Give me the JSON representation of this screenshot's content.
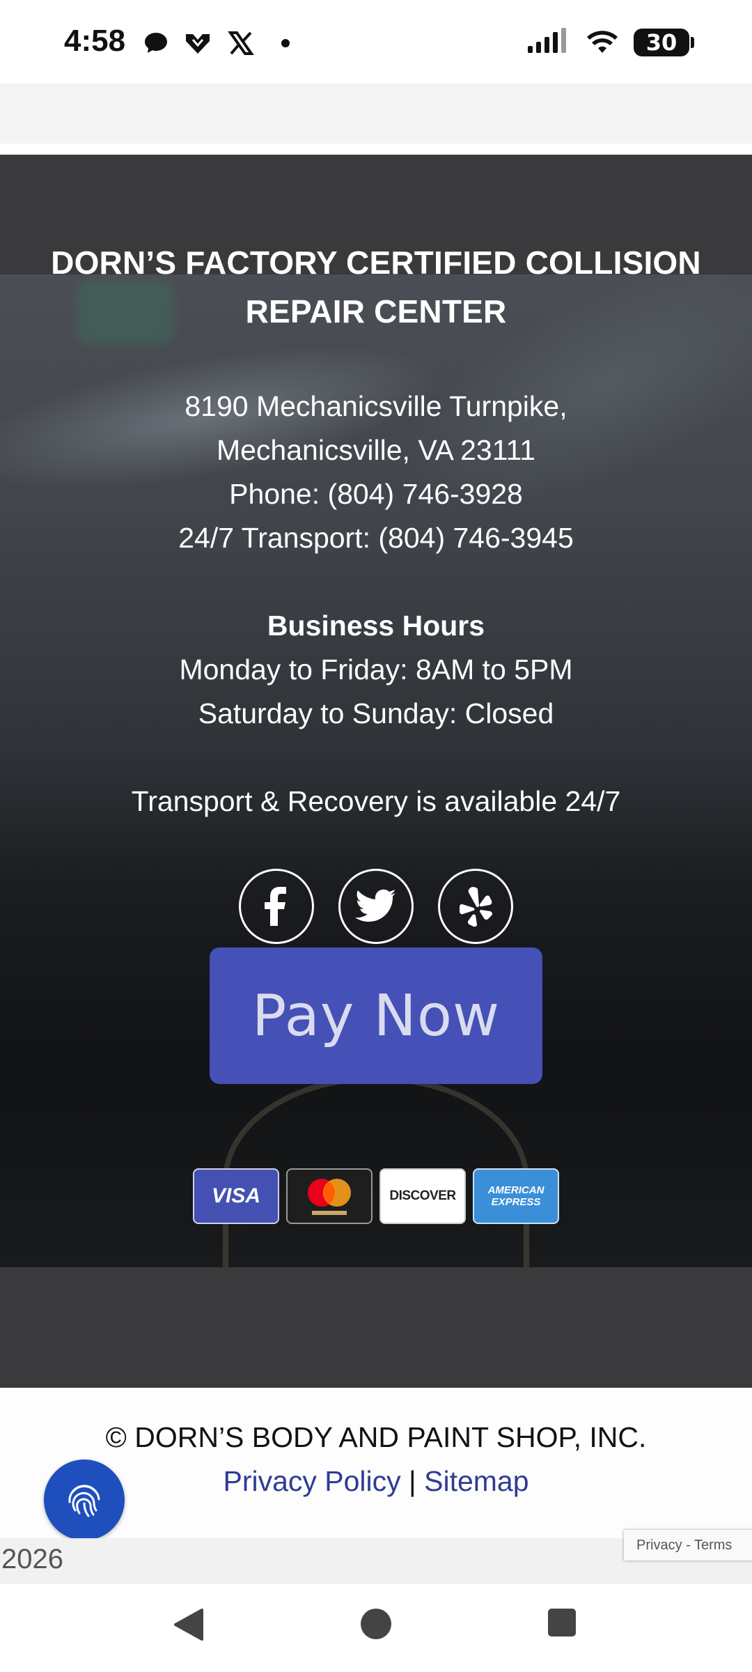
{
  "status_bar": {
    "time": "4:58",
    "battery": "30",
    "notification_icons": [
      "chat-bubble-icon",
      "inbox-down-icon",
      "x-logo-icon",
      "dot-icon"
    ]
  },
  "footer": {
    "title": "DORN’S FACTORY CERTIFIED COLLISION REPAIR CENTER",
    "address_line1": "8190 Mechanicsville Turnpike,",
    "address_line2": "Mechanicsville, VA 23111",
    "phone": "Phone: (804) 746-3928",
    "transport_phone": "24/7 Transport: (804) 746-3945",
    "hours_heading": "Business Hours",
    "hours_weekday": "Monday to Friday: 8AM to 5PM",
    "hours_weekend": "Saturday to Sunday: Closed",
    "transport_note": "Transport & Recovery is available 24/7",
    "social": [
      "facebook-icon",
      "twitter-icon",
      "yelp-icon"
    ],
    "pay_button": "Pay Now",
    "cards": {
      "visa": "VISA",
      "discover": "DISCOVER",
      "amex_line1": "AMERICAN",
      "amex_line2": "EXPRESS"
    }
  },
  "bottom": {
    "copyright": "© DORN’S BODY AND PAINT SHOP, INC.",
    "privacy": "Privacy Policy",
    "separator": "|",
    "sitemap": "Sitemap",
    "year": "2026",
    "recaptcha": "Privacy - Terms"
  },
  "colors": {
    "pay_button": "#4551b6",
    "link": "#2f3b93",
    "fingerprint_button": "#1e4fbd",
    "dark_section": "#3a3a3c"
  }
}
